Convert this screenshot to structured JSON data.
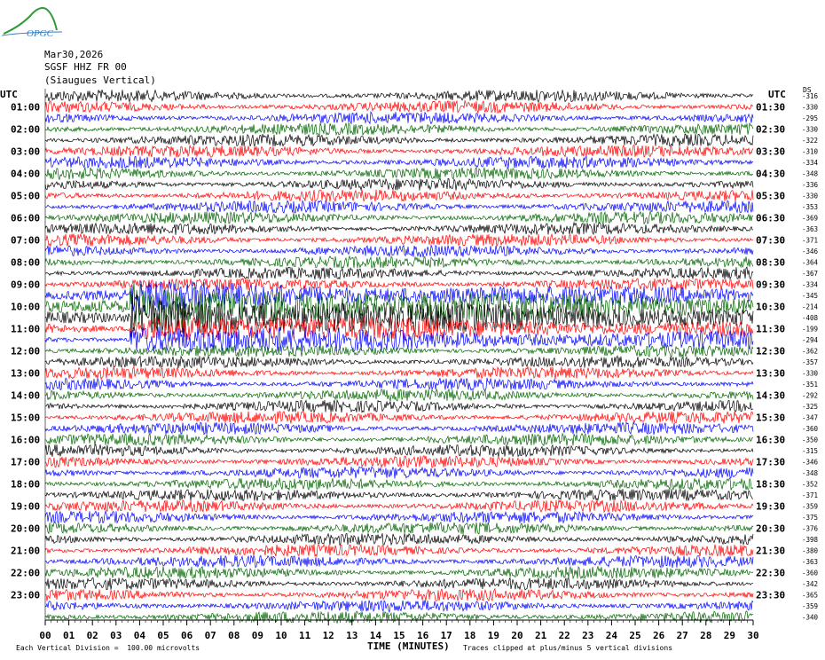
{
  "logo": {
    "text": "OPGC",
    "icon": "mountain-logo-icon",
    "color": "#2f7fbf"
  },
  "header": {
    "date": "Mar30,2026",
    "station": "SGSF HHZ FR 00",
    "location": "(Siaugues Vertical)"
  },
  "axis": {
    "left_title": "UTC",
    "right_title": "UTC",
    "ds_title": "DS",
    "x_title": "TIME (MINUTES)"
  },
  "footer": {
    "left": "Each Vertical Division =  100.00 microvolts",
    "right": "Traces clipped at plus/minus 5 vertical divisions"
  },
  "colors": {
    "trace_cycle": [
      "#000000",
      "#ff0000",
      "#0000ff",
      "#006400"
    ]
  },
  "chart_data": {
    "type": "line",
    "title": "SGSF HHZ FR 00",
    "xlabel": "TIME (MINUTES)",
    "xlim": [
      0,
      30
    ],
    "x_ticks": [
      "00",
      "01",
      "02",
      "03",
      "04",
      "05",
      "06",
      "07",
      "08",
      "09",
      "10",
      "11",
      "12",
      "13",
      "14",
      "15",
      "16",
      "17",
      "18",
      "19",
      "20",
      "21",
      "22",
      "23",
      "24",
      "25",
      "26",
      "27",
      "28",
      "29",
      "30"
    ],
    "left_hour_labels": [
      "01:00",
      "02:00",
      "03:00",
      "04:00",
      "05:00",
      "06:00",
      "07:00",
      "08:00",
      "09:00",
      "10:00",
      "11:00",
      "12:00",
      "13:00",
      "14:00",
      "15:00",
      "16:00",
      "17:00",
      "18:00",
      "19:00",
      "20:00",
      "21:00",
      "22:00",
      "23:00"
    ],
    "right_hour_labels": [
      "01:30",
      "02:30",
      "03:30",
      "04:30",
      "05:30",
      "06:30",
      "07:30",
      "08:30",
      "09:30",
      "10:30",
      "11:30",
      "12:30",
      "13:30",
      "14:30",
      "15:30",
      "16:30",
      "17:30",
      "18:30",
      "19:30",
      "20:30",
      "21:30",
      "22:30",
      "23:30"
    ],
    "ds_values": [
      "-316",
      "-330",
      "-295",
      "-330",
      "-322",
      "-310",
      "-334",
      "-348",
      "-336",
      "-330",
      "-353",
      "-369",
      "-363",
      "-371",
      "-346",
      "-364",
      "-367",
      "-334",
      "-345",
      "-214",
      "-408",
      "-199",
      "-294",
      "-362",
      "-357",
      "-330",
      "-351",
      "-292",
      "-325",
      "-347",
      "-360",
      "-350",
      "-315",
      "-346",
      "-348",
      "-352",
      "-371",
      "-359",
      "-375",
      "-376",
      "-398",
      "-380",
      "-363",
      "-360",
      "-342",
      "-365",
      "-359",
      "-340"
    ],
    "trace_count": 48,
    "trace_minutes": 30,
    "clip_divisions": 5,
    "division_microvolts": 100.0,
    "event": {
      "trace_start": 18,
      "trace_end": 22,
      "minute_start": 3.6,
      "minute_end": 30,
      "note": ""
    }
  }
}
